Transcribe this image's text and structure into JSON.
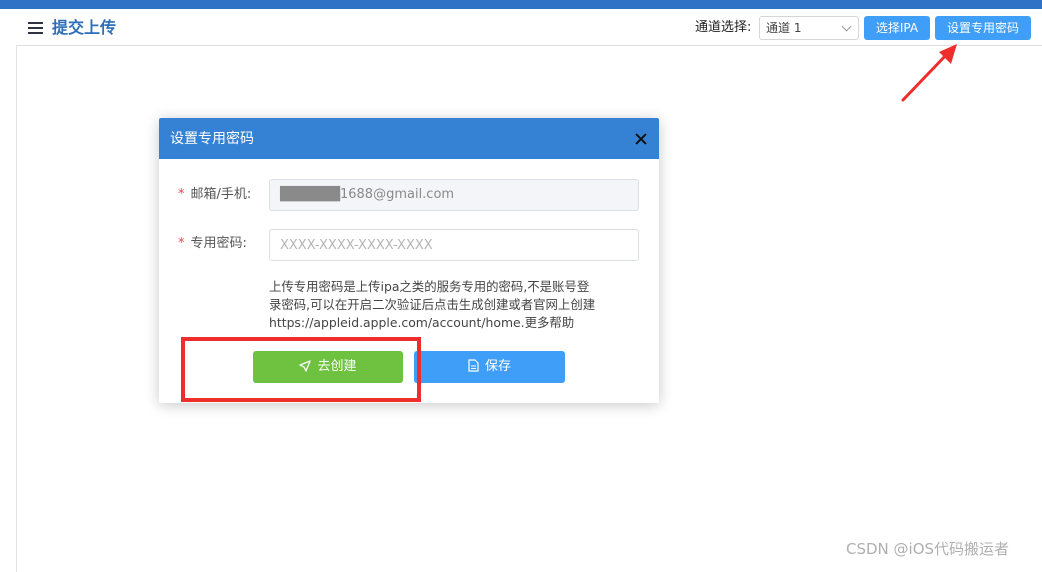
{
  "header": {
    "title": "提交上传",
    "channel_label": "通道选择:",
    "channel_selected": "通道 1",
    "select_ipa_label": "选择IPA",
    "set_password_label": "设置专用密码"
  },
  "dialog": {
    "title": "设置专用密码",
    "required_mark": "*",
    "email_label": "邮箱/手机:",
    "email_value": "██████1688@gmail.com",
    "password_label": "专用密码:",
    "password_placeholder": "XXXX-XXXX-XXXX-XXXX",
    "hint_line1": "上传专用密码是上传ipa之类的服务专用的密码,不是账号登",
    "hint_line2": "录密码,可以在开启二次验证后点击生成创建或者官网上创建",
    "hint_line3": "https://appleid.apple.com/account/home.更多帮助",
    "create_label": "去创建",
    "save_label": "保存"
  },
  "watermark": "CSDN @iOS代码搬运者",
  "colors": {
    "top_strip": "#2f72c6",
    "dialog_header": "#3581d4",
    "primary_button": "#3f9ef7",
    "create_button": "#6ec240",
    "annotation_red": "#ee2d2d"
  }
}
